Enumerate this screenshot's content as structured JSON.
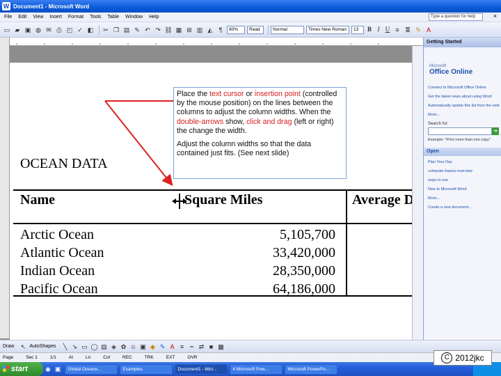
{
  "window": {
    "title": "Document1 - Microsoft Word"
  },
  "menu": [
    "File",
    "Edit",
    "View",
    "Insert",
    "Format",
    "Tools",
    "Table",
    "Window",
    "Help"
  ],
  "help_box": "Type a question for help",
  "toolbar": {
    "zoom": "80%",
    "read": "Read",
    "style": "Normal",
    "font": "Times New Roman",
    "size": "13"
  },
  "callout": {
    "p1": [
      {
        "t": "Place the ",
        "c": "black"
      },
      {
        "t": "text cursor",
        "c": "red"
      },
      {
        "t": " or ",
        "c": "black"
      },
      {
        "t": "insertion point",
        "c": "red"
      },
      {
        "t": " (controlled by the mouse position) on the lines between the columns to adjust the column widths. When the ",
        "c": "black"
      },
      {
        "t": "double-arrows",
        "c": "red"
      },
      {
        "t": " show, ",
        "c": "black"
      },
      {
        "t": "click and drag",
        "c": "red"
      },
      {
        "t": " (left or right) the change the width.",
        "c": "black"
      }
    ],
    "p2": "Adjust the column widths so that the data contained just fits. (See next slide)"
  },
  "document": {
    "heading": "OCEAN DATA",
    "columns": [
      "Name",
      "Square Miles",
      "Average Do"
    ],
    "rows": [
      {
        "name": "Arctic Ocean",
        "miles": "5,105,700"
      },
      {
        "name": "Atlantic Ocean",
        "miles": "33,420,000"
      },
      {
        "name": "Indian Ocean",
        "miles": "28,350,000"
      },
      {
        "name": "Pacific Ocean",
        "miles": "64,186,000"
      }
    ]
  },
  "taskpane": {
    "header": "Getting Started",
    "logo": "Office Online",
    "logo_sub": "Microsoft",
    "links": [
      "Connect to Microsoft Office Online",
      "Get the latest news about using Word",
      "Automatically update this list from the web",
      "More..."
    ],
    "search_label": "Search for:",
    "example": "Example: \"Print more than one copy\"",
    "open_header": "Open",
    "open_items": [
      "Plan Your Day",
      "computer-basics-overview",
      "ways to use",
      "New to Microsoft Word",
      "More...",
      "Create a new document..."
    ]
  },
  "drawbar": {
    "draw": "Draw",
    "autoshapes": "AutoShapes"
  },
  "status": [
    "Page",
    "Sec 1",
    "1/1",
    "At",
    "Ln",
    "Col",
    "REC",
    "TRK",
    "EXT",
    "OVR"
  ],
  "taskbar": {
    "start": "start",
    "buttons": [
      "Global Oceans...",
      "Examples",
      "Document1 - Micr...",
      "4 Microsoft Pow...",
      "Microsoft PowerPo..."
    ]
  },
  "copyright": {
    "symbol": "C",
    "text": "2012jkc"
  }
}
